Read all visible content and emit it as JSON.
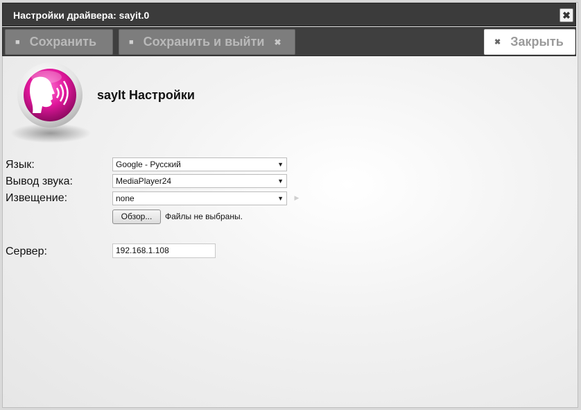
{
  "window": {
    "title": "Настройки драйвера: sayit.0",
    "close_glyph": "✖"
  },
  "toolbar": {
    "save_label": "Сохранить",
    "save_exit_label": "Сохранить и выйти",
    "close_label": "Закрыть"
  },
  "plugin": {
    "title": "sayIt Настройки",
    "logo_icon": "speaking-head-icon",
    "logo_color": "#e0179b"
  },
  "form": {
    "language_label": "Язык:",
    "language_value": "Google - Русский",
    "output_label": "Вывод звука:",
    "output_value": "MediaPlayer24",
    "notification_label": "Извещение:",
    "notification_value": "none",
    "browse_label": "Обзор...",
    "no_file_text": "Файлы не выбраны.",
    "server_label": "Сервер:",
    "server_value": "192.168.1.108"
  }
}
